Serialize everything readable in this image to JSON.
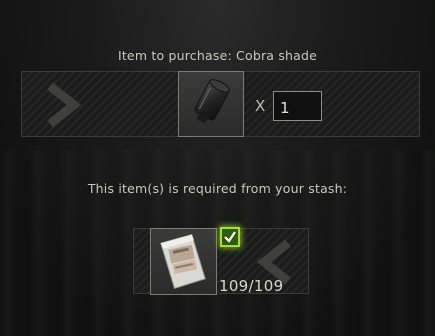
{
  "purchase": {
    "title": "Item to purchase: Cobra shade",
    "item_icon": "cobra-shade-suppressor-icon",
    "multiplier_symbol": "X",
    "quantity": "1"
  },
  "requirement": {
    "title": "This item(s) is required from your stash:",
    "item_icon": "ration-pack-icon",
    "checked": true,
    "count": "109/109"
  },
  "colors": {
    "accent_green": "#a3e032",
    "checkbox_fill": "#2f5a06"
  }
}
